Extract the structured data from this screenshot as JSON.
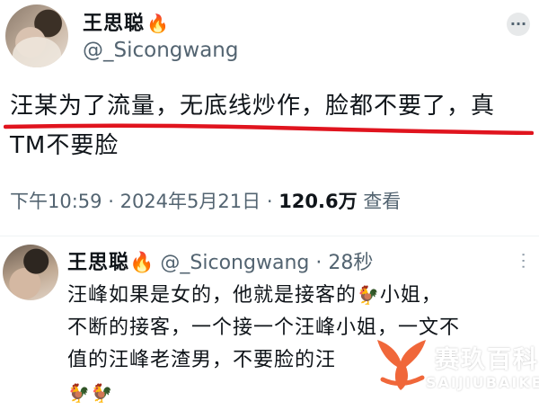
{
  "post": {
    "author_name": "王思聪",
    "author_badge_emoji": "🔥",
    "handle": "@_Sicongwang",
    "text": "汪某为了流量，无底线炒作，脸都不要了，真TM不要脸",
    "time": "下午10:59",
    "separator": "·",
    "date": "2024年5月21日",
    "views": "120.6万",
    "views_label": "查看",
    "more_icon": "more-icon"
  },
  "reply": {
    "author_name": "王思聪",
    "author_badge_emoji": "🔥",
    "handle": "@_Sicongwang",
    "separator": "·",
    "time_ago": "28秒",
    "text_line1_a": "汪峰如果是女的，他就是接客的",
    "rooster": "🐓",
    "text_line1_b": "小姐，",
    "text_line2": "不断的接客，一个接一个汪峰小姐，一文不",
    "text_line3": "值的汪峰老渣男，不要脸的",
    "text_line3_tail": "汪",
    "line4_emojis": "🐓🐓",
    "more_glyph": "···"
  },
  "watermark": {
    "title": "赛玖百科",
    "subtitle": "SAIJIUBAIKE",
    "color": "#f0673a"
  },
  "colors": {
    "underline": "#e0141e",
    "muted": "#536471",
    "text": "#0f1419"
  }
}
